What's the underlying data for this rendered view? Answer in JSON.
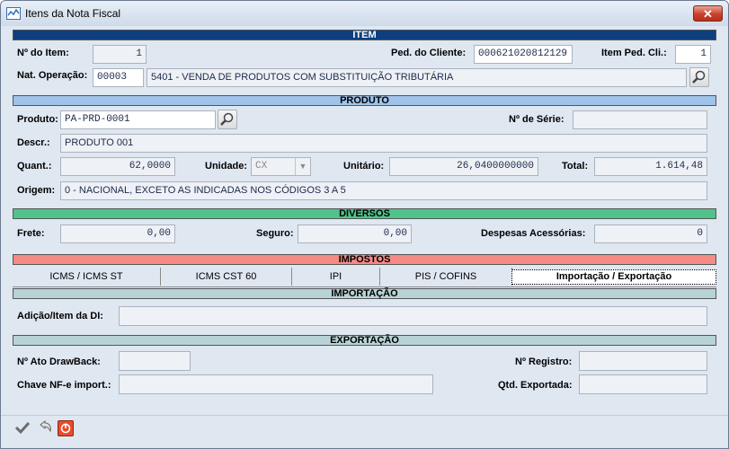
{
  "window": {
    "title": "Itens da Nota Fiscal",
    "close": "✕"
  },
  "item": {
    "header": "ITEM",
    "n_item_label": "Nº do Item:",
    "n_item": "1",
    "ped_cliente_label": "Ped. do Cliente:",
    "ped_cliente": "000621020812129",
    "item_ped_cli_label": "Item Ped. Cli.:",
    "item_ped_cli": "1",
    "nat_operacao_label": "Nat. Operação:",
    "nat_code": "00003",
    "nat_desc": "5401 - VENDA DE PRODUTOS COM SUBSTITUIÇÃO TRIBUTÁRIA"
  },
  "produto": {
    "header": "PRODUTO",
    "produto_label": "Produto:",
    "produto": "PA-PRD-0001",
    "serie_label": "Nº de Série:",
    "serie": "",
    "descr_label": "Descr.:",
    "descr": "PRODUTO 001",
    "quant_label": "Quant.:",
    "quant": "62,0000",
    "unidade_label": "Unidade:",
    "unidade": "CX",
    "unitario_label": "Unitário:",
    "unitario": "26,0400000000",
    "total_label": "Total:",
    "total": "1.614,48",
    "origem_label": "Origem:",
    "origem": "0 - NACIONAL, EXCETO AS INDICADAS NOS CÓDIGOS 3 A 5"
  },
  "diversos": {
    "header": "DIVERSOS",
    "frete_label": "Frete:",
    "frete": "0,00",
    "seguro_label": "Seguro:",
    "seguro": "0,00",
    "despesas_label": "Despesas Acessórias:",
    "despesas": "0"
  },
  "impostos": {
    "header": "IMPOSTOS",
    "tabs": [
      "ICMS / ICMS ST",
      "ICMS CST 60",
      "IPI",
      "PIS / COFINS",
      "Importação / Exportação"
    ]
  },
  "importacao": {
    "header": "IMPORTAÇÃO",
    "adicao_label": "Adição/Item da DI:",
    "adicao": ""
  },
  "exportacao": {
    "header": "EXPORTAÇÃO",
    "ato_label": "Nº Ato DrawBack:",
    "ato": "",
    "registro_label": "Nº Registro:",
    "registro": "",
    "chave_label": "Chave NF-e import.:",
    "chave": "",
    "qtd_label": "Qtd. Exportada:",
    "qtd": ""
  },
  "toolbar": {
    "confirm_icon": "checkmark-icon",
    "undo_icon": "undo-icon",
    "power_icon": "power-icon"
  }
}
